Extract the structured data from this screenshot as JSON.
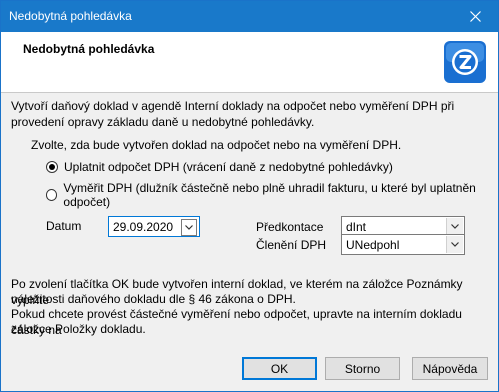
{
  "window": {
    "title": "Nedobytná pohledávka"
  },
  "header": {
    "title": "Nedobytná pohledávka"
  },
  "intro": {
    "line1": "Vytvoří daňový doklad v agendě Interní doklady na odpočet nebo vyměření DPH při",
    "line2": "provedení opravy základu daně u nedobytné pohledávky."
  },
  "choice": {
    "prompt": "Zvolte, zda bude vytvořen doklad na odpočet nebo na vyměření DPH.",
    "option1": "Uplatnit odpočet DPH (vrácení daně z nedobytné pohledávky)",
    "option2": "Vyměřit DPH (dlužník částečně nebo plně uhradil fakturu, u které byl uplatněn odpočet)",
    "selected": 1
  },
  "form": {
    "datum_label": "Datum",
    "datum_value": "29.09.2020",
    "predkontace_label": "Předkontace",
    "predkontace_value": "dInt",
    "cleneni_label": "Členění DPH",
    "cleneni_value": "UNedpohl"
  },
  "note": {
    "line1": "Po zvolení tlačítka OK bude vytvořen interní doklad, ve kterém na záložce Poznámky vyplňte",
    "line2": "náležitosti daňového dokladu dle § 46 zákona o DPH.",
    "line3": "Pokud chcete provést částečné vyměření nebo odpočet, upravte na interním dokladu částky na",
    "line4": "záložce Položky dokladu."
  },
  "buttons": {
    "ok": "OK",
    "storno": "Storno",
    "help": "Nápověda"
  }
}
